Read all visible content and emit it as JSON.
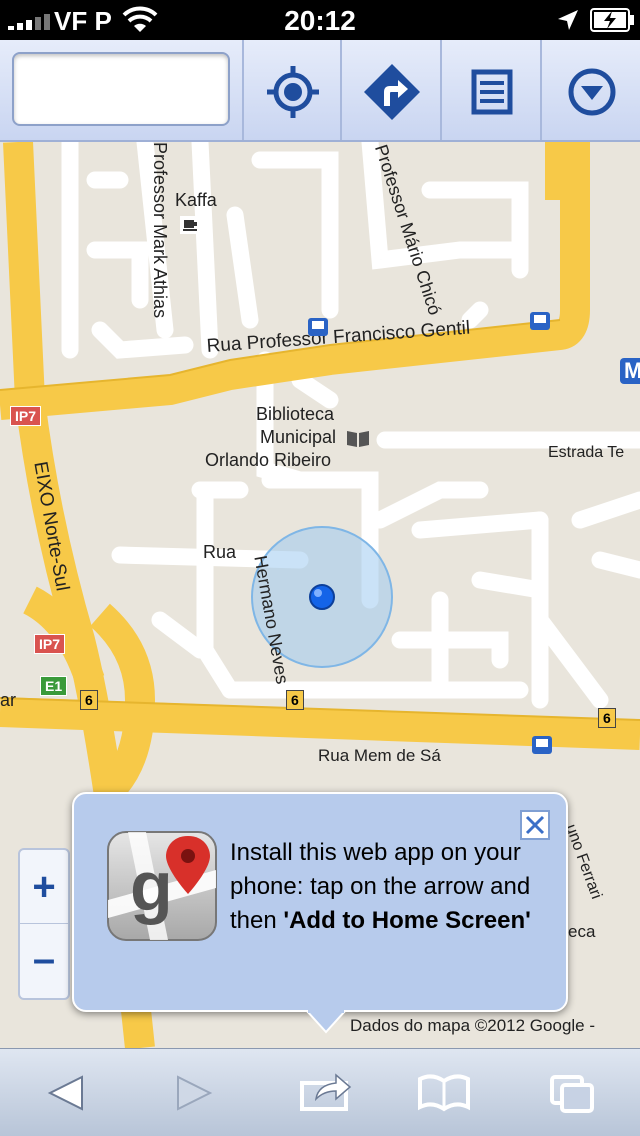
{
  "status_bar": {
    "carrier": "VF P",
    "time": "20:12",
    "icons": [
      "signal-icon",
      "wifi-icon",
      "location-arrow-icon",
      "battery-charging-icon"
    ]
  },
  "toolbar": {
    "search": {
      "value": "",
      "placeholder": ""
    },
    "buttons": [
      {
        "name": "my-location",
        "icon": "crosshair-icon"
      },
      {
        "name": "directions",
        "icon": "turn-right-icon"
      },
      {
        "name": "list",
        "icon": "list-icon"
      },
      {
        "name": "menu",
        "icon": "chevron-down-circle-icon"
      }
    ]
  },
  "map": {
    "labels": {
      "kaffa": "Kaffa",
      "prof_mark_athias": "Professor Mark Athias",
      "prof_mario_chico": "Professor Mário Chicó",
      "rua_francisco_gentil": "Rua Professor Francisco Gentil",
      "biblioteca_1": "Biblioteca",
      "biblioteca_2": "Municipal",
      "biblioteca_3": "Orlando Ribeiro",
      "estrada": "Estrada Te",
      "eixo": "EIXO Norte-Sul",
      "ip7": "IP7",
      "e1": "E1",
      "route6": "6",
      "rua_hermano_1": "Rua",
      "rua_hermano_2": "Hermano Neves",
      "ar": "ar",
      "rua_mem_de_sa": "Rua Mem de Sá",
      "no_ferrari": "uno Ferrari",
      "eca": "eca",
      "metro": "M"
    },
    "colors": {
      "background": "#e9e5dc",
      "major_road": "#f7c948",
      "minor_road": "#ffffff",
      "blue_dot": "#1464e8",
      "accuracy_circle": "#9ecbf0"
    }
  },
  "zoom": {
    "plus": "+",
    "minus": "–"
  },
  "popup": {
    "text_prefix": "Install this web app on your phone: tap on the arrow and then ",
    "text_bold": "'Add to Home Screen'",
    "icon": "google-maps-icon",
    "close_icon": "close-icon"
  },
  "attribution": "Dados do mapa ©2012 Google -",
  "safari_bar": {
    "buttons": [
      "back-icon",
      "forward-icon",
      "share-icon",
      "bookmarks-icon",
      "tabs-icon"
    ]
  }
}
